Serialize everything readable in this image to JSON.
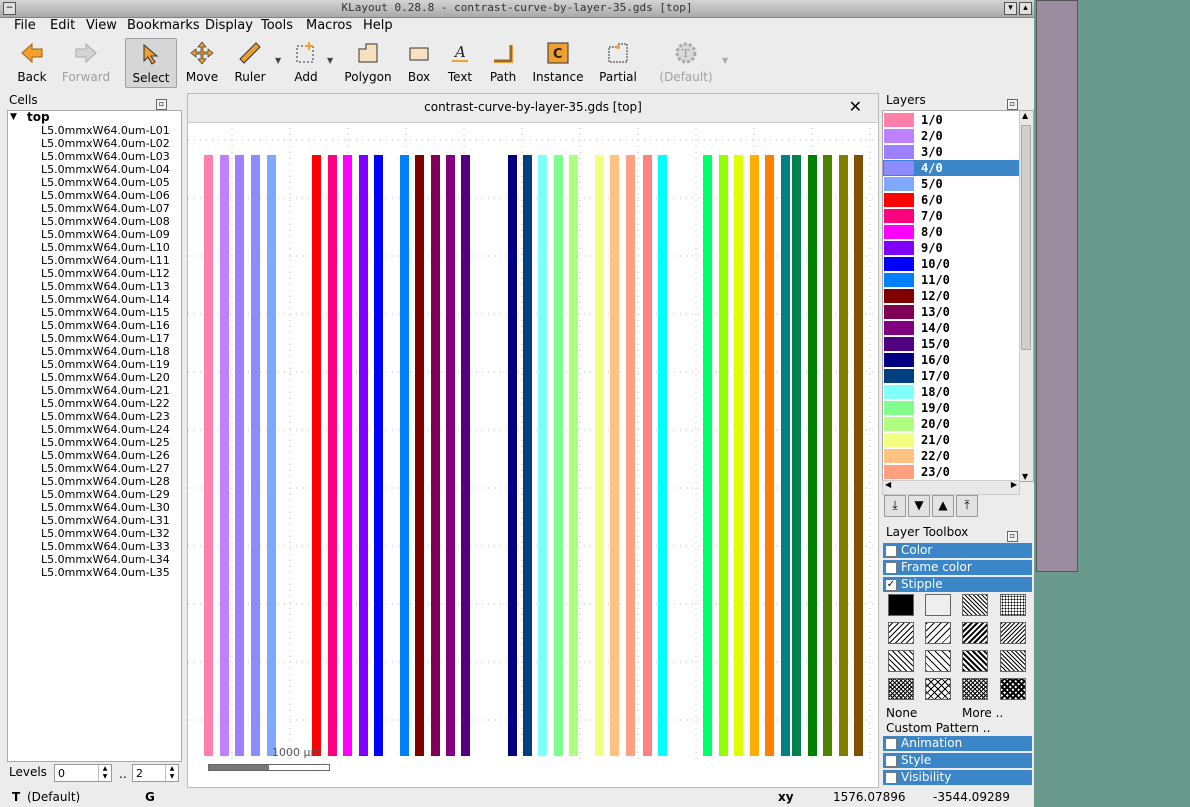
{
  "window": {
    "title": "KLayout 0.28.8 - contrast-curve-by-layer-35.gds [top]"
  },
  "menu": [
    "File",
    "Edit",
    "View",
    "Bookmarks",
    "Display",
    "Tools",
    "Macros",
    "Help"
  ],
  "toolbar": {
    "back": "Back",
    "forward": "Forward",
    "select": "Select",
    "move": "Move",
    "ruler": "Ruler",
    "add": "Add",
    "polygon": "Polygon",
    "box": "Box",
    "text": "Text",
    "path": "Path",
    "instance": "Instance",
    "partial": "Partial",
    "default": "(Default)"
  },
  "cells": {
    "title": "Cells",
    "root": "top",
    "items": [
      "L5.0mmxW64.0um-L01",
      "L5.0mmxW64.0um-L02",
      "L5.0mmxW64.0um-L03",
      "L5.0mmxW64.0um-L04",
      "L5.0mmxW64.0um-L05",
      "L5.0mmxW64.0um-L06",
      "L5.0mmxW64.0um-L07",
      "L5.0mmxW64.0um-L08",
      "L5.0mmxW64.0um-L09",
      "L5.0mmxW64.0um-L10",
      "L5.0mmxW64.0um-L11",
      "L5.0mmxW64.0um-L12",
      "L5.0mmxW64.0um-L13",
      "L5.0mmxW64.0um-L14",
      "L5.0mmxW64.0um-L15",
      "L5.0mmxW64.0um-L16",
      "L5.0mmxW64.0um-L17",
      "L5.0mmxW64.0um-L18",
      "L5.0mmxW64.0um-L19",
      "L5.0mmxW64.0um-L20",
      "L5.0mmxW64.0um-L21",
      "L5.0mmxW64.0um-L22",
      "L5.0mmxW64.0um-L23",
      "L5.0mmxW64.0um-L24",
      "L5.0mmxW64.0um-L25",
      "L5.0mmxW64.0um-L26",
      "L5.0mmxW64.0um-L27",
      "L5.0mmxW64.0um-L28",
      "L5.0mmxW64.0um-L29",
      "L5.0mmxW64.0um-L30",
      "L5.0mmxW64.0um-L31",
      "L5.0mmxW64.0um-L32",
      "L5.0mmxW64.0um-L33",
      "L5.0mmxW64.0um-L34",
      "L5.0mmxW64.0um-L35"
    ]
  },
  "levels": {
    "label": "Levels",
    "from": "0",
    "sep": "..",
    "to": "2"
  },
  "canvas": {
    "title": "contrast-curve-by-layer-35.gds [top]",
    "scale_label": "1000 µm",
    "stripe_colors": [
      "#ff80a8",
      "#c080ff",
      "#9c80ff",
      "#8c8cff",
      "#80a8ff",
      "#ff0000",
      "#ff0080",
      "#ff00ff",
      "#8000ff",
      "#0000ff",
      "#0080ff",
      "#800000",
      "#800057",
      "#800080",
      "#500080",
      "#000080",
      "#004080",
      "#80fffb",
      "#80ff8d",
      "#afff80",
      "#f3ff80",
      "#ffc280",
      "#ffa080",
      "#ff8080",
      "#00ffff",
      "#01ff6b",
      "#91ff00",
      "#ddff00",
      "#ffae00",
      "#ff8000",
      "#008080",
      "#008050",
      "#008000",
      "#508000",
      "#808000",
      "#805000"
    ]
  },
  "layers": {
    "title": "Layers",
    "items": [
      {
        "name": "1/0",
        "color": "#ff80a8"
      },
      {
        "name": "2/0",
        "color": "#c080ff"
      },
      {
        "name": "3/0",
        "color": "#9c80ff"
      },
      {
        "name": "4/0",
        "color": "#8c8cff"
      },
      {
        "name": "5/0",
        "color": "#80a8ff"
      },
      {
        "name": "6/0",
        "color": "#ff0000"
      },
      {
        "name": "7/0",
        "color": "#ff0080"
      },
      {
        "name": "8/0",
        "color": "#ff00ff"
      },
      {
        "name": "9/0",
        "color": "#8000ff"
      },
      {
        "name": "10/0",
        "color": "#0000ff"
      },
      {
        "name": "11/0",
        "color": "#0080ff"
      },
      {
        "name": "12/0",
        "color": "#800000"
      },
      {
        "name": "13/0",
        "color": "#800057"
      },
      {
        "name": "14/0",
        "color": "#800080"
      },
      {
        "name": "15/0",
        "color": "#500080"
      },
      {
        "name": "16/0",
        "color": "#000080"
      },
      {
        "name": "17/0",
        "color": "#004080"
      },
      {
        "name": "18/0",
        "color": "#80fffb"
      },
      {
        "name": "19/0",
        "color": "#80ff8d"
      },
      {
        "name": "20/0",
        "color": "#afff80"
      },
      {
        "name": "21/0",
        "color": "#f3ff80"
      },
      {
        "name": "22/0",
        "color": "#ffc280"
      },
      {
        "name": "23/0",
        "color": "#ffa080"
      }
    ],
    "selected": "4/0"
  },
  "toolbox": {
    "title": "Layer Toolbox",
    "color": "Color",
    "frame_color": "Frame color",
    "stipple": "Stipple",
    "stipple_check": "✓",
    "none": "None",
    "more": "More ..",
    "custom": "Custom Pattern ..",
    "animation": "Animation",
    "style": "Style",
    "visibility": "Visibility"
  },
  "status": {
    "mode": "T",
    "default": "(Default)",
    "g": "G",
    "xy_label": "xy",
    "x": "1576.07896",
    "y": "-3544.09289"
  }
}
